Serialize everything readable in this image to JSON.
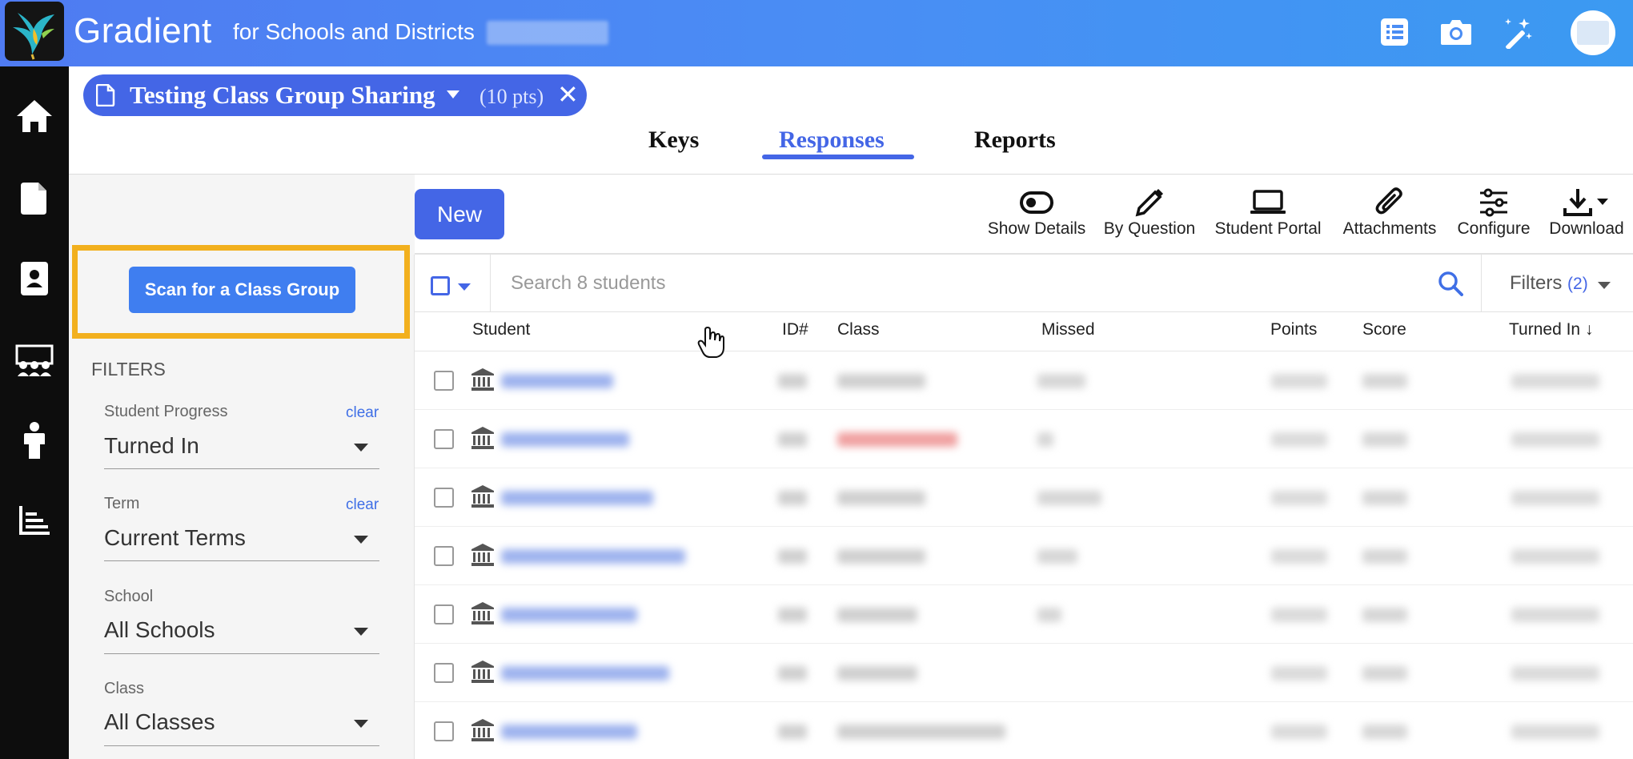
{
  "header": {
    "brand": "Gradient",
    "subtitle": "for Schools and Districts",
    "icons": [
      "list-icon",
      "camera-icon",
      "magic-wand-icon"
    ]
  },
  "sidenav": {
    "items": [
      "home-icon",
      "document-icon",
      "contact-card-icon",
      "class-group-icon",
      "student-icon",
      "reports-chart-icon"
    ]
  },
  "assignment": {
    "title": "Testing Class Group Sharing",
    "points": "(10 pts)",
    "close": "✕"
  },
  "tabs": [
    {
      "label": "Keys"
    },
    {
      "label": "Responses",
      "active": true
    },
    {
      "label": "Reports"
    }
  ],
  "left_panel": {
    "scan_button": "Scan for a Class Group",
    "filters_heading": "FILTERS",
    "clear_label": "clear",
    "filters": [
      {
        "label": "Student Progress",
        "value": "Turned In",
        "clearable": true
      },
      {
        "label": "Term",
        "value": "Current Terms",
        "clearable": true
      },
      {
        "label": "School",
        "value": "All Schools",
        "clearable": false
      },
      {
        "label": "Class",
        "value": "All Classes",
        "clearable": false
      }
    ]
  },
  "toolbar": {
    "new_label": "New",
    "tools": [
      {
        "label": "Show Details",
        "icon": "toggle-icon"
      },
      {
        "label": "By Question",
        "icon": "pencil-icon"
      },
      {
        "label": "Student Portal",
        "icon": "laptop-icon"
      },
      {
        "label": "Attachments",
        "icon": "paperclip-icon"
      },
      {
        "label": "Configure",
        "icon": "sliders-icon"
      },
      {
        "label": "Download",
        "icon": "download-icon"
      }
    ]
  },
  "search": {
    "placeholder": "Search 8 students",
    "filters_label": "Filters",
    "filters_count": "(2)"
  },
  "table": {
    "columns": [
      "Student",
      "ID#",
      "Class",
      "Missed",
      "Points",
      "Score",
      "Turned In ↓"
    ]
  },
  "colors": {
    "accent": "#4466e6",
    "highlight": "#f2b01e",
    "scan_button": "#3f7ef0"
  }
}
